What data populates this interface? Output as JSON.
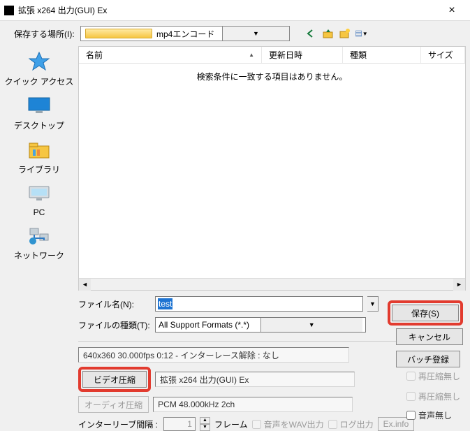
{
  "title": "拡張 x264 出力(GUI) Ex",
  "toolbar": {
    "save_in_label": "保存する場所(I):",
    "folder": "mp4エンコード"
  },
  "columns": [
    "名前",
    "更新日時",
    "種類",
    "サイズ"
  ],
  "empty_message": "検索条件に一致する項目はありません。",
  "places": [
    {
      "id": "quick",
      "label": "クイック アクセス"
    },
    {
      "id": "desktop",
      "label": "デスクトップ"
    },
    {
      "id": "library",
      "label": "ライブラリ"
    },
    {
      "id": "pc",
      "label": "PC"
    },
    {
      "id": "network",
      "label": "ネットワーク"
    }
  ],
  "form": {
    "filename_label": "ファイル名(N):",
    "filename_value": "test",
    "filetype_label": "ファイルの種類(T):",
    "filetype_value": "All Support Formats (*.*)",
    "save_btn": "保存(S)",
    "cancel_btn": "キャンセル",
    "batch_btn": "バッチ登録"
  },
  "info": {
    "media_line": "640x360  30.000fps  0:12  -  インターレース解除 : なし",
    "video_btn": "ビデオ圧縮",
    "video_value": "拡張 x264 出力(GUI) Ex",
    "audio_btn": "オーディオ圧縮",
    "audio_value": "PCM 48.000kHz 2ch",
    "recompress_none": "再圧縮無し",
    "audio_none": "音声無し",
    "interleave_label": "インターリーブ間隔 :",
    "interleave_val": "1",
    "frame_label": "フレーム",
    "wav_label": "音声をWAV出力",
    "log_label": "ログ出力",
    "exinfo": "Ex.info"
  }
}
